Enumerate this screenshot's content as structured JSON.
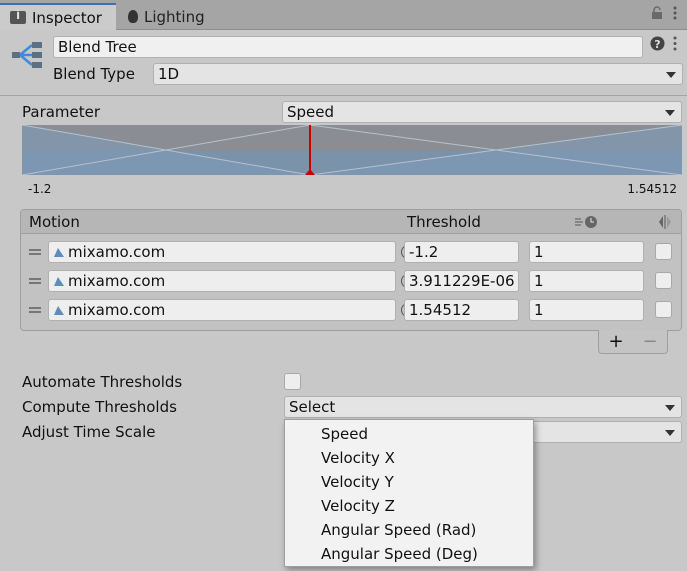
{
  "tabs": [
    {
      "label": "Inspector",
      "icon": "info-icon",
      "active": true
    },
    {
      "label": "Lighting",
      "icon": "lightbulb-icon",
      "active": false
    }
  ],
  "header": {
    "name_value": "Blend Tree",
    "blend_type_label": "Blend Type",
    "blend_type_value": "1D"
  },
  "parameter": {
    "label": "Parameter",
    "value": "Speed",
    "range_min": "-1.2",
    "range_max": "1.54512"
  },
  "motion_table": {
    "col_motion": "Motion",
    "col_threshold": "Threshold",
    "rows": [
      {
        "motion": "mixamo.com",
        "threshold": "-1.2",
        "time_scale": "1",
        "mirror": false
      },
      {
        "motion": "mixamo.com",
        "threshold": "3.911229E-06",
        "time_scale": "1",
        "mirror": false
      },
      {
        "motion": "mixamo.com",
        "threshold": "1.54512",
        "time_scale": "1",
        "mirror": false
      }
    ],
    "add_label": "+",
    "remove_label": "−"
  },
  "options": {
    "automate_label": "Automate Thresholds",
    "automate_checked": false,
    "compute_label": "Compute Thresholds",
    "compute_value": "Select",
    "adjust_label": "Adjust Time Scale"
  },
  "popup": {
    "items": [
      "Speed",
      "Velocity X",
      "Velocity Y",
      "Velocity Z",
      "Angular Speed (Rad)",
      "Angular Speed (Deg)"
    ]
  },
  "colors": {
    "accent": "#3a72b0",
    "graph_fill": "#7b92ab",
    "marker": "#cc0000"
  }
}
